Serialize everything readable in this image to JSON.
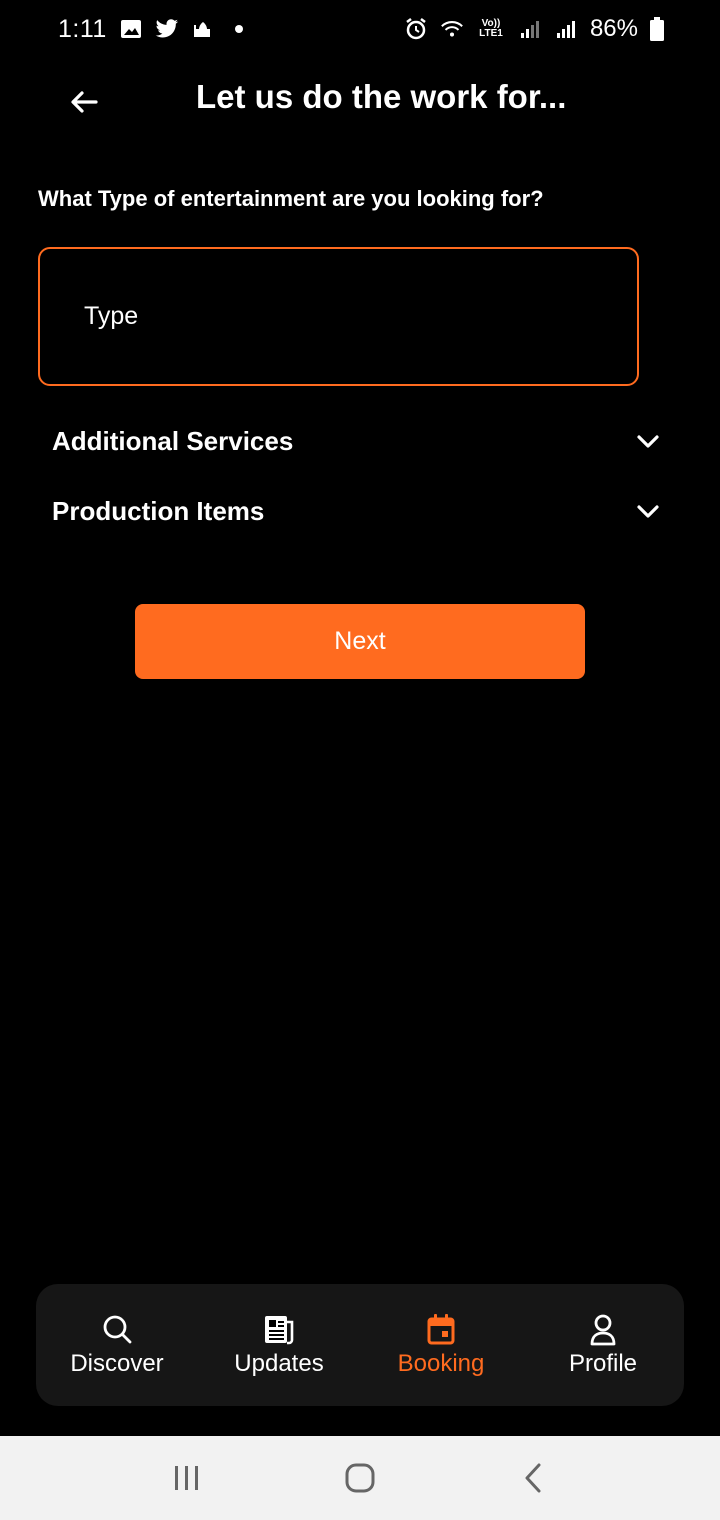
{
  "status_bar": {
    "time": "1:11",
    "volte_label": "Vo))",
    "lte_label": "LTE1",
    "battery": "86%",
    "icons": [
      "gallery-icon",
      "twitter-icon",
      "mosque-icon",
      "notification-dot",
      "alarm-icon",
      "wifi-icon",
      "signal-icon",
      "signal-icon",
      "battery-icon"
    ]
  },
  "header": {
    "back_icon": "arrow-left-icon",
    "title": "Let us do the work for..."
  },
  "form": {
    "question": "What Type of entertainment are you looking for?",
    "type_field_label": "Type"
  },
  "sections": [
    {
      "label": "Additional Services",
      "icon": "chevron-down-icon"
    },
    {
      "label": "Production Items",
      "icon": "chevron-down-icon"
    }
  ],
  "actions": {
    "next_label": "Next"
  },
  "bottom_nav": {
    "items": [
      {
        "label": "Discover",
        "icon": "search-icon",
        "active": false
      },
      {
        "label": "Updates",
        "icon": "newspaper-icon",
        "active": false
      },
      {
        "label": "Booking",
        "icon": "calendar-icon",
        "active": true
      },
      {
        "label": "Profile",
        "icon": "person-icon",
        "active": false
      }
    ]
  },
  "colors": {
    "accent": "#ff6b1f",
    "background": "#000000",
    "nav_background": "#161616",
    "system_nav_background": "#f2f2f2"
  }
}
